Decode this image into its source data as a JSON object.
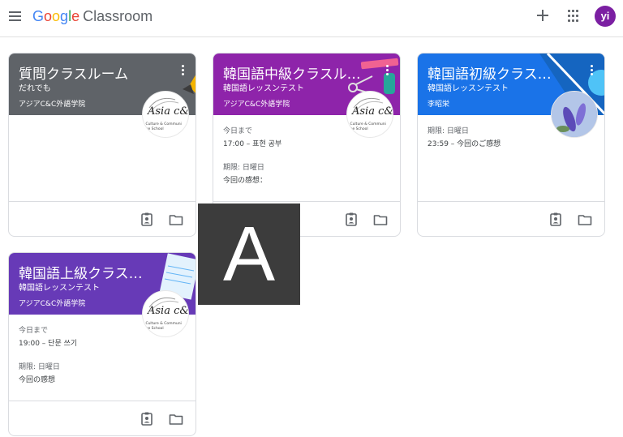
{
  "header": {
    "brand_google": [
      "G",
      "o",
      "o",
      "g",
      "l",
      "e"
    ],
    "product": "Classroom",
    "avatar_initials": "yi",
    "accent": "#7b1fa2"
  },
  "icons": {
    "menu": "hamburger-menu-icon",
    "create": "plus-icon",
    "apps": "apps-grid-icon",
    "more": "more-vert-icon",
    "work": "assignment-ind-icon",
    "folder": "folder-icon"
  },
  "cards": [
    {
      "title": "質問クラスルーム",
      "section": "だれでも",
      "teacher": "アジアC&C外語学院",
      "color": "#5f6368",
      "logo_text": "Asia c&c",
      "logo_sub": "ia Culture & Communi\nnage School",
      "due": []
    },
    {
      "title": "韓国語中級クラスルーム",
      "section": "韓国語レッスンテスト",
      "teacher": "アジアC&C外語学院",
      "color": "#8e24aa",
      "logo_text": "Asia c&c",
      "logo_sub": "ia Culture & Communi\nnage School",
      "due": [
        {
          "label": "今日まで",
          "item": "17:00 – 표현 공부"
        },
        {
          "label": "期限: 日曜日",
          "item": "今回の感想："
        }
      ]
    },
    {
      "title": "韓国語初級クラスルーム",
      "section": "韓国語レッスンテスト",
      "teacher": "李昭栄",
      "color": "#1a73e8",
      "due": [
        {
          "label": "期限: 日曜日",
          "item": "23:59 – 今回のご感想"
        }
      ]
    },
    {
      "title": "韓国語上級クラスルーム",
      "section": "韓国語レッスンテスト",
      "teacher": "アジアC&C外語学院",
      "color": "#673ab7",
      "logo_text": "Asia c&c",
      "logo_sub": "ia Culture & Communi\nnage School",
      "due": [
        {
          "label": "今日まで",
          "item": "19:00 – 단문 쓰기"
        },
        {
          "label": "期限: 日曜日",
          "item": "今回の感想"
        }
      ]
    }
  ],
  "overlay": {
    "letter": "A"
  }
}
